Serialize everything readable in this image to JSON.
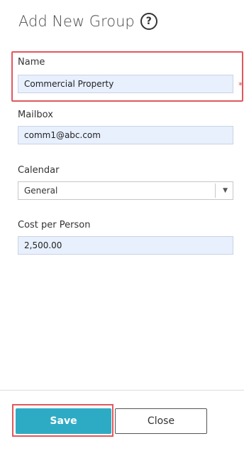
{
  "header": {
    "title": "Add New Group",
    "help_icon": "?"
  },
  "form": {
    "name": {
      "label": "Name",
      "value": "Commercial Property",
      "required_marker": "*"
    },
    "mailbox": {
      "label": "Mailbox",
      "value": "comm1@abc.com"
    },
    "calendar": {
      "label": "Calendar",
      "value": "General"
    },
    "cost": {
      "label": "Cost per Person",
      "value": "2,500.00"
    }
  },
  "actions": {
    "save_label": "Save",
    "close_label": "Close"
  },
  "colors": {
    "accent": "#2eabc4",
    "highlight": "#e0585d",
    "field_bg": "#e8f0fe"
  }
}
